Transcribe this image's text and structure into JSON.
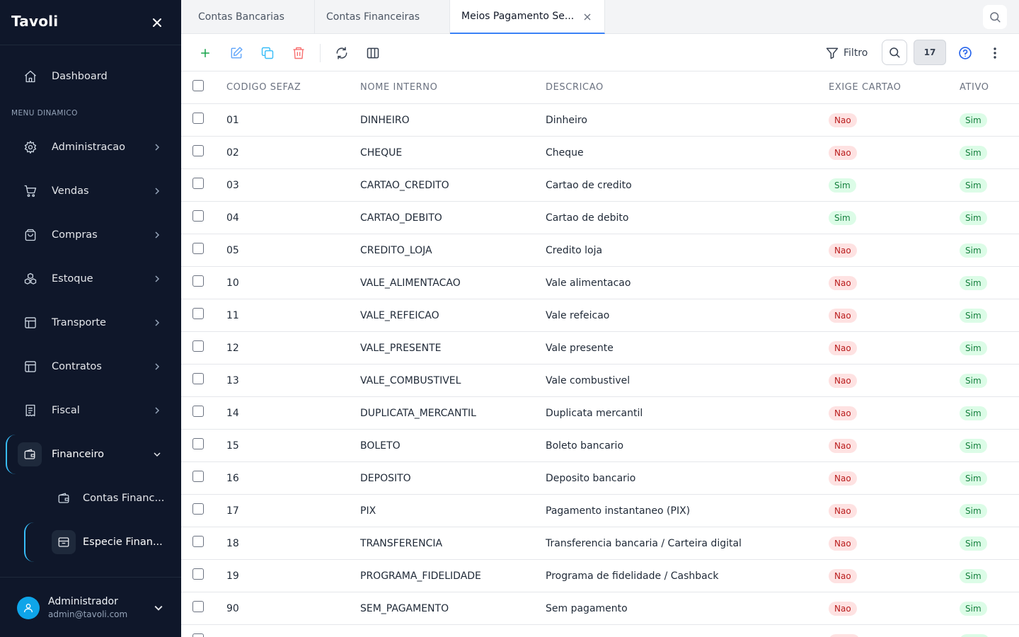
{
  "app": {
    "title": "Tavoli"
  },
  "sidebar": {
    "dashboard": "Dashboard",
    "section": "MENU DINAMICO",
    "items": [
      {
        "label": "Administracao",
        "icon": "gear-icon"
      },
      {
        "label": "Vendas",
        "icon": "cart-icon"
      },
      {
        "label": "Compras",
        "icon": "bag-icon"
      },
      {
        "label": "Estoque",
        "icon": "boxes-icon"
      },
      {
        "label": "Transporte",
        "icon": "layout-icon"
      },
      {
        "label": "Contratos",
        "icon": "layout-icon"
      },
      {
        "label": "Fiscal",
        "icon": "receipt-icon"
      },
      {
        "label": "Financeiro",
        "icon": "wallet-icon"
      }
    ],
    "subitems": [
      {
        "label": "Contas Financ...",
        "icon": "wallet-icon"
      },
      {
        "label": "Especie Finan...",
        "icon": "archive-icon"
      }
    ],
    "user": {
      "name": "Administrador",
      "email": "admin@tavoli.com"
    }
  },
  "tabs": [
    {
      "label": "Contas Bancarias"
    },
    {
      "label": "Contas Financeiras"
    },
    {
      "label": "Meios Pagamento Se..."
    }
  ],
  "toolbar": {
    "filter_label": "Filtro",
    "count": "17"
  },
  "table": {
    "columns": [
      "CODIGO SEFAZ",
      "NOME INTERNO",
      "DESCRICAO",
      "EXIGE CARTAO",
      "ATIVO"
    ],
    "rows": [
      {
        "codigo": "01",
        "nome": "DINHEIRO",
        "descricao": "Dinheiro",
        "exige": "Nao",
        "ativo": "Sim"
      },
      {
        "codigo": "02",
        "nome": "CHEQUE",
        "descricao": "Cheque",
        "exige": "Nao",
        "ativo": "Sim"
      },
      {
        "codigo": "03",
        "nome": "CARTAO_CREDITO",
        "descricao": "Cartao de credito",
        "exige": "Sim",
        "ativo": "Sim"
      },
      {
        "codigo": "04",
        "nome": "CARTAO_DEBITO",
        "descricao": "Cartao de debito",
        "exige": "Sim",
        "ativo": "Sim"
      },
      {
        "codigo": "05",
        "nome": "CREDITO_LOJA",
        "descricao": "Credito loja",
        "exige": "Nao",
        "ativo": "Sim"
      },
      {
        "codigo": "10",
        "nome": "VALE_ALIMENTACAO",
        "descricao": "Vale alimentacao",
        "exige": "Nao",
        "ativo": "Sim"
      },
      {
        "codigo": "11",
        "nome": "VALE_REFEICAO",
        "descricao": "Vale refeicao",
        "exige": "Nao",
        "ativo": "Sim"
      },
      {
        "codigo": "12",
        "nome": "VALE_PRESENTE",
        "descricao": "Vale presente",
        "exige": "Nao",
        "ativo": "Sim"
      },
      {
        "codigo": "13",
        "nome": "VALE_COMBUSTIVEL",
        "descricao": "Vale combustivel",
        "exige": "Nao",
        "ativo": "Sim"
      },
      {
        "codigo": "14",
        "nome": "DUPLICATA_MERCANTIL",
        "descricao": "Duplicata mercantil",
        "exige": "Nao",
        "ativo": "Sim"
      },
      {
        "codigo": "15",
        "nome": "BOLETO",
        "descricao": "Boleto bancario",
        "exige": "Nao",
        "ativo": "Sim"
      },
      {
        "codigo": "16",
        "nome": "DEPOSITO",
        "descricao": "Deposito bancario",
        "exige": "Nao",
        "ativo": "Sim"
      },
      {
        "codigo": "17",
        "nome": "PIX",
        "descricao": "Pagamento instantaneo (PIX)",
        "exige": "Nao",
        "ativo": "Sim"
      },
      {
        "codigo": "18",
        "nome": "TRANSFERENCIA",
        "descricao": "Transferencia bancaria / Carteira digital",
        "exige": "Nao",
        "ativo": "Sim"
      },
      {
        "codigo": "19",
        "nome": "PROGRAMA_FIDELIDADE",
        "descricao": "Programa de fidelidade / Cashback",
        "exige": "Nao",
        "ativo": "Sim"
      },
      {
        "codigo": "90",
        "nome": "SEM_PAGAMENTO",
        "descricao": "Sem pagamento",
        "exige": "Nao",
        "ativo": "Sim"
      }
    ]
  },
  "colors": {
    "sidebar_bg": "#0f172a",
    "accent": "#38bdf8",
    "active_tab": "#3b82f6",
    "add": "#16a34a",
    "edit": "#60a5fa",
    "copy": "#38bdf8",
    "delete": "#f87171",
    "badge_no_bg": "#fee2e2",
    "badge_yes_bg": "#dcfce7"
  }
}
